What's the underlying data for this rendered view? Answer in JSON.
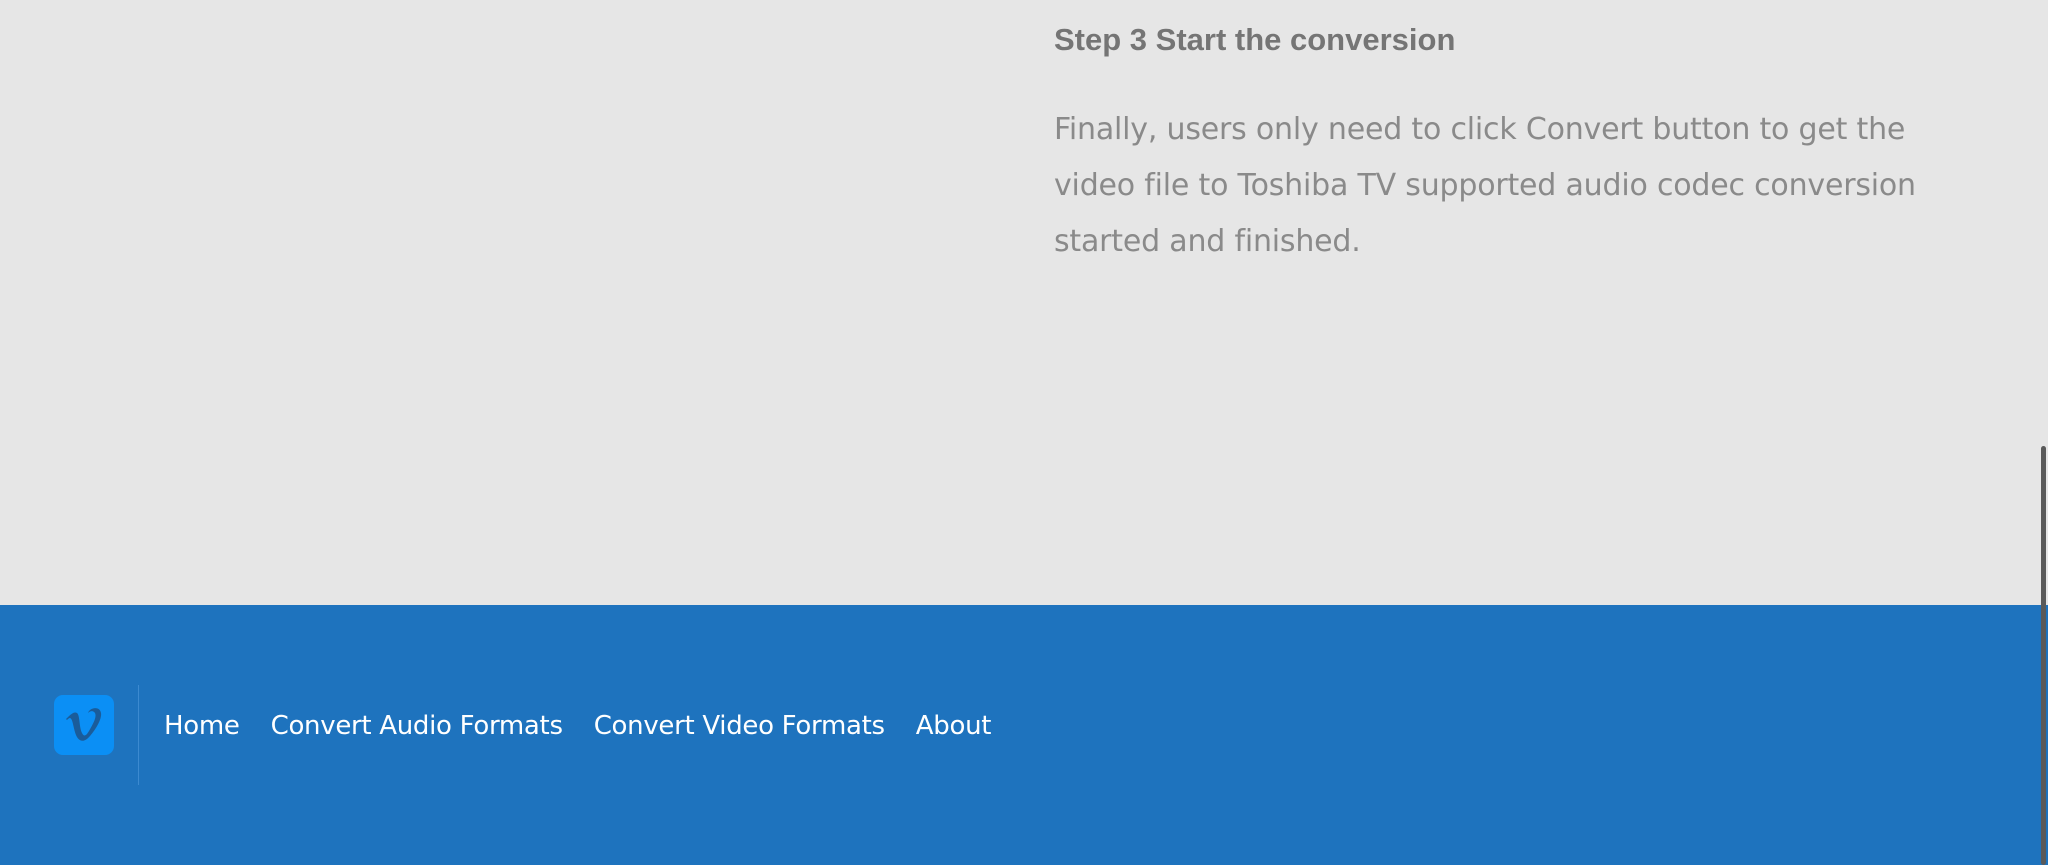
{
  "article": {
    "step_title": "Step 3 Start the conversion",
    "step_text": "Finally, users only need to click Convert button to get the video file to Toshiba TV supported audio codec conversion started and finished."
  },
  "footer": {
    "logo_icon": "vimeo-icon",
    "links": [
      {
        "label": "Home"
      },
      {
        "label": "Convert Audio Formats"
      },
      {
        "label": "Convert Video Formats"
      },
      {
        "label": "About"
      }
    ]
  },
  "colors": {
    "page_background": "#e6e6e6",
    "footer_background": "#1e73be",
    "logo_background": "#0b8ff5",
    "title_text": "#757575",
    "body_text": "#8a8a8a"
  }
}
